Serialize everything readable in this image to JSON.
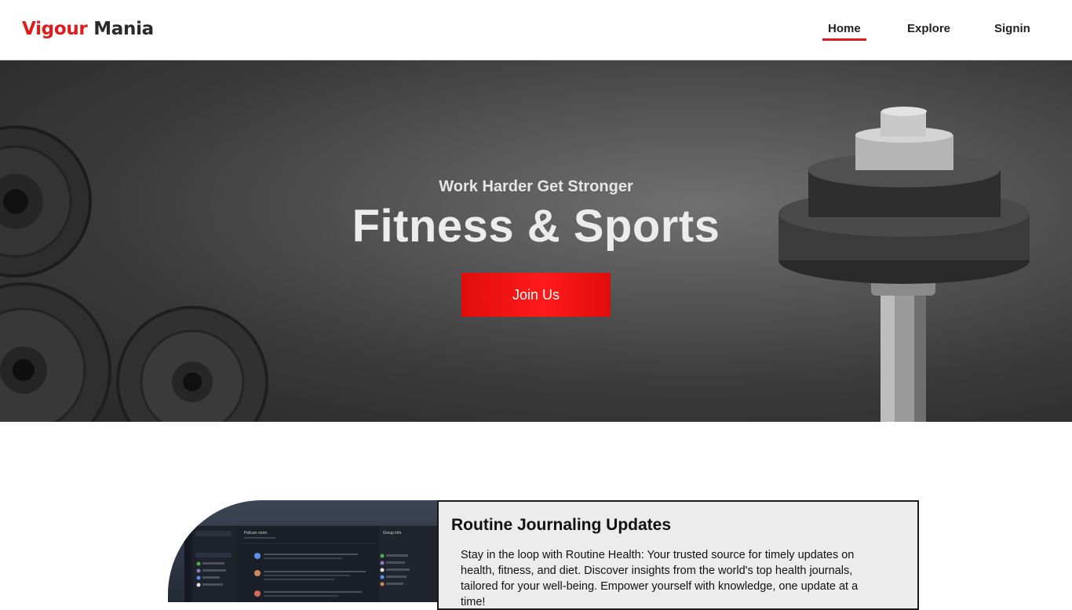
{
  "brand": {
    "part1": "Vigour",
    "part2": "Mania"
  },
  "nav": {
    "home": "Home",
    "explore": "Explore",
    "signin": "Signin"
  },
  "hero": {
    "subtitle": "Work Harder Get Stronger",
    "title": "Fitness & Sports",
    "cta": "Join Us"
  },
  "feature": {
    "title": "Routine Journaling Updates",
    "body": "Stay in the loop with Routine Health: Your trusted source for timely updates on health, fitness, and diet. Discover insights from the world's top health journals, tailored for your well-being. Empower yourself with knowledge, one update at a time!"
  },
  "preview": {
    "room_title": "Pelican room",
    "panel_title": "Group info"
  },
  "colors": {
    "accent": "#e01b1b",
    "card_bg": "#ececec"
  }
}
